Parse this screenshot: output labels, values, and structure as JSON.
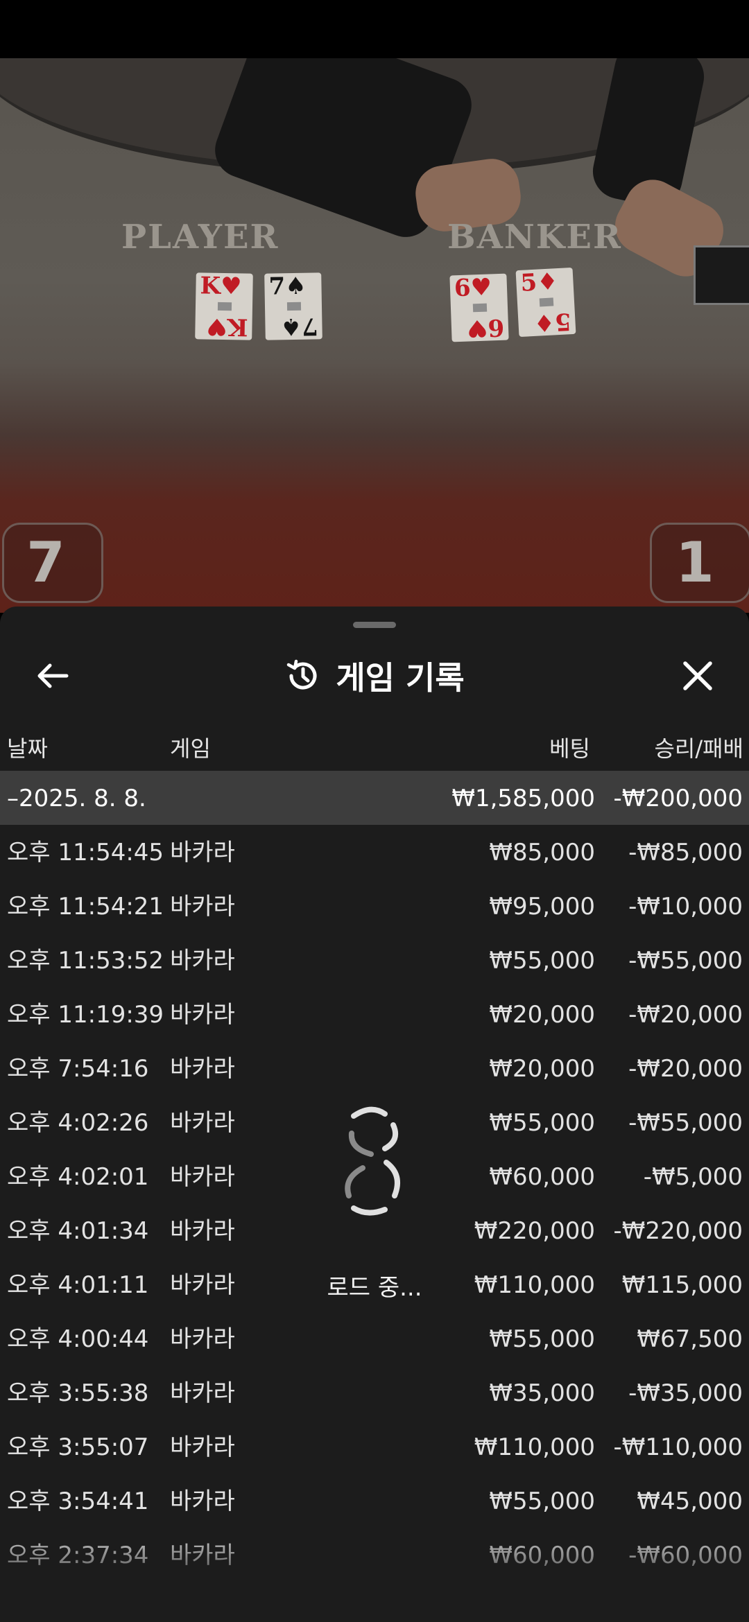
{
  "video": {
    "player_label": "PLAYER",
    "banker_label": "BANKER",
    "player_cards": [
      {
        "rank": "K",
        "suit": "♥",
        "color": "red"
      },
      {
        "rank": "7",
        "suit": "♠",
        "color": "blk"
      }
    ],
    "banker_cards": [
      {
        "rank": "6",
        "suit": "♥",
        "color": "red"
      },
      {
        "rank": "5",
        "suit": "♦",
        "color": "red"
      }
    ],
    "player_score": "7",
    "banker_score": "1"
  },
  "sheet": {
    "title": "게임 기록",
    "title_icon": "history-icon",
    "back_icon": "arrow-left-icon",
    "close_icon": "close-icon",
    "columns": {
      "date": "날짜",
      "game": "게임",
      "bet": "베팅",
      "winloss": "승리/패배"
    },
    "group": {
      "date": "–2025. 8. 8.",
      "bet": "₩1,585,000",
      "winloss": "-₩200,000"
    },
    "rows": [
      {
        "time": "오후 11:54:45",
        "game": "바카라",
        "bet": "₩85,000",
        "winloss": "-₩85,000"
      },
      {
        "time": "오후 11:54:21",
        "game": "바카라",
        "bet": "₩95,000",
        "winloss": "-₩10,000"
      },
      {
        "time": "오후 11:53:52",
        "game": "바카라",
        "bet": "₩55,000",
        "winloss": "-₩55,000"
      },
      {
        "time": "오후 11:19:39",
        "game": "바카라",
        "bet": "₩20,000",
        "winloss": "-₩20,000"
      },
      {
        "time": "오후 7:54:16",
        "game": "바카라",
        "bet": "₩20,000",
        "winloss": "-₩20,000"
      },
      {
        "time": "오후 4:02:26",
        "game": "바카라",
        "bet": "₩55,000",
        "winloss": "-₩55,000"
      },
      {
        "time": "오후 4:02:01",
        "game": "바카라",
        "bet": "₩60,000",
        "winloss": "-₩5,000"
      },
      {
        "time": "오후 4:01:34",
        "game": "바카라",
        "bet": "₩220,000",
        "winloss": "-₩220,000"
      },
      {
        "time": "오후 4:01:11",
        "game": "바카라",
        "bet": "₩110,000",
        "winloss": "₩115,000"
      },
      {
        "time": "오후 4:00:44",
        "game": "바카라",
        "bet": "₩55,000",
        "winloss": "₩67,500"
      },
      {
        "time": "오후 3:55:38",
        "game": "바카라",
        "bet": "₩35,000",
        "winloss": "-₩35,000"
      },
      {
        "time": "오후 3:55:07",
        "game": "바카라",
        "bet": "₩110,000",
        "winloss": "-₩110,000"
      },
      {
        "time": "오후 3:54:41",
        "game": "바카라",
        "bet": "₩55,000",
        "winloss": "₩45,000"
      },
      {
        "time": "오후 2:37:34",
        "game": "바카라",
        "bet": "₩60,000",
        "winloss": "-₩60,000"
      }
    ],
    "loading_text": "로드 중..."
  },
  "colors": {
    "sheet_bg": "#1c1c1c",
    "group_bg": "#3d3d3d",
    "text": "#e3e3e3"
  }
}
